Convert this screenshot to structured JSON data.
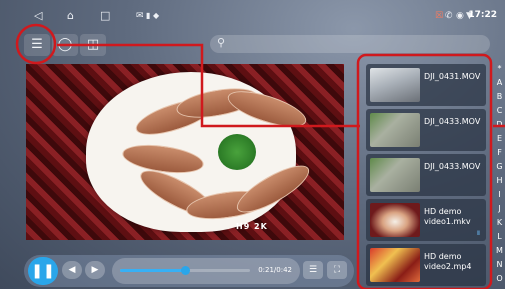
{
  "status_bar": {
    "icons": [
      "back-icon",
      "home-icon",
      "recents-icon",
      "message-icon",
      "battery-icon",
      "location-icon",
      "no-call-icon",
      "phone-icon",
      "location-pin-icon",
      "wifi-icon"
    ],
    "time": "17:22"
  },
  "toolbar": {
    "buttons": [
      "list-icon",
      "loop-icon",
      "screen-icon"
    ],
    "search_placeholder": ""
  },
  "video": {
    "watermark": "H9 2K"
  },
  "playlist": [
    {
      "name": "DJI_0431.MOV",
      "thumb": "road"
    },
    {
      "name": "DJI_0433.MOV",
      "thumb": "aerial"
    },
    {
      "name": "DJI_0433.MOV",
      "thumb": "aerial"
    },
    {
      "name": "HD demo video1.mkv",
      "thumb": "food",
      "badge": "Ⅱ"
    },
    {
      "name": "HD demo video2.mp4",
      "thumb": "festival"
    }
  ],
  "alphabet": [
    "*",
    "A",
    "B",
    "C",
    "D",
    "E",
    "F",
    "G",
    "H",
    "I",
    "J",
    "K",
    "L",
    "M",
    "N",
    "O"
  ],
  "player": {
    "progress": 0.5,
    "time_text": "0:21/0:42"
  },
  "colors": {
    "accent": "#2aa6ea",
    "annotation": "#d0191d"
  }
}
